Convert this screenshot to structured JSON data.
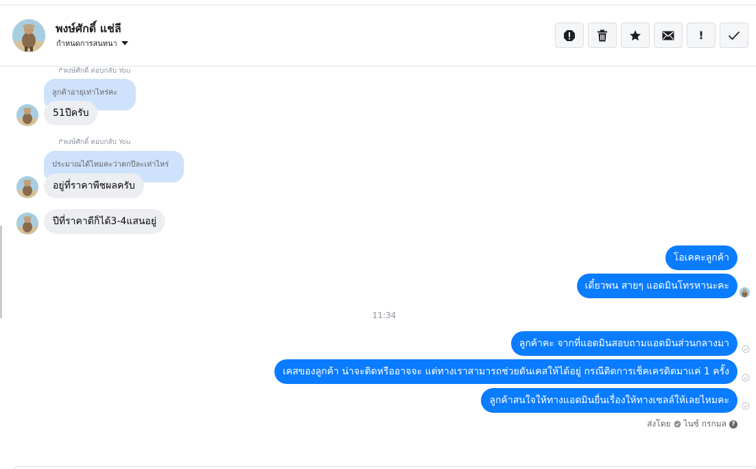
{
  "header": {
    "contact_name": "พงษ์ศักดิ์ แช่ลี",
    "assign_label": "กำหนดการสนทนา",
    "actions": [
      {
        "name": "report-icon",
        "label": ""
      },
      {
        "name": "trash-icon",
        "label": ""
      },
      {
        "name": "star-icon",
        "label": ""
      },
      {
        "name": "mail-icon",
        "label": ""
      },
      {
        "name": "exclamation-icon",
        "label": "!"
      },
      {
        "name": "check-icon",
        "label": ""
      }
    ]
  },
  "messages": {
    "incoming": [
      {
        "reply_meta": "พงษ์ศักดิ์ ตอบกลับ You",
        "quoted": "ลูกค้าอายุเท่าไหร่คะ",
        "text": "51ปีครับ"
      },
      {
        "reply_meta": "พงษ์ศักดิ์ ตอบกลับ You",
        "quoted": "ประมาณได้ไหมคะว่าตกปีละเท่าไหร่",
        "text": "อยู่ที่ราคาพืชผลครับ"
      },
      {
        "reply_meta": "",
        "quoted": "",
        "text": "ปีที่ราคาดีก็ได้3-4แสนอยู่"
      }
    ],
    "outgoing_group1": [
      {
        "text": "โอเคคะลูกค้า"
      },
      {
        "text": "เดี๋ยวพน สายๆ แอดมินโทรหานะคะ"
      }
    ],
    "timestamp": "11:34",
    "outgoing_group2": [
      {
        "text": "ลูกค้าคะ จากที่แอดมินสอบถามแอดมินส่วนกลางมา"
      },
      {
        "text": "เคสของลูกค้า น่าจะติดหรืออาจจะ แต่ทางเราสามารถช่วยดันเคสให้ได้อยู่ กรณีติดการเช็คเครดิตมาแค่ 1 ครั้ง"
      },
      {
        "text": "ลูกค้าสนใจให้ทางแอดมินยื่นเรื่องให้ทางเซลล์ให้เลยไหมคะ"
      }
    ],
    "sent_by_prefix": "ส่งโดย",
    "sent_by_name": "ไนซ์ กรกมล",
    "help_glyph": "?"
  },
  "colors": {
    "outgoing_bubble": "#0a7cff",
    "incoming_bubble": "#eceef1",
    "quote_bubble": "#cfe2fb"
  }
}
